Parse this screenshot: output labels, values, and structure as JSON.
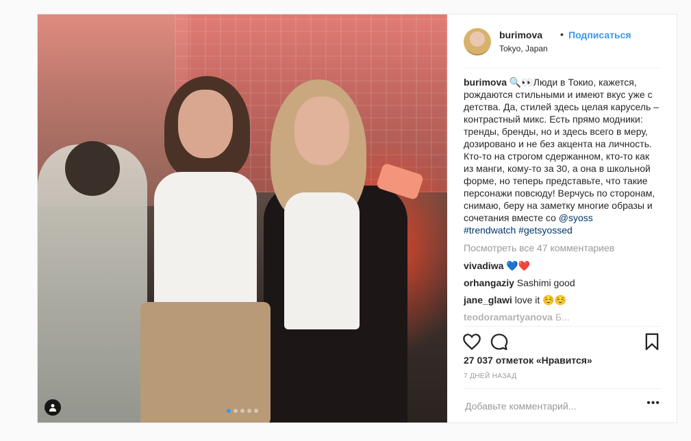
{
  "post": {
    "username": "burimova",
    "separator": "•",
    "follow_label": "Подписаться",
    "location": "Tokyo, Japan",
    "caption_user": "burimova",
    "caption_text": " 🔍👀Люди в Токио, кажется, рождаются стильными и имеют вкус уже с детства. Да, стилей здесь целая карусель – контрастный микс. Есть прямо модники: тренды, бренды, но и здесь всего в меру, дозировано и не без акцента на личность. Кто-то на строгом сдержанном, кто-то как из манги, кому-то за 30, а она в школьной форме, но теперь представьте, что такие персонажи повсюду! Верчусь по сторонам, снимаю, беру на заметку многие образы и сочетания вместе со ",
    "mention": "@syoss",
    "hashtags": "#trendwatch #getsyossed",
    "view_all": "Посмотреть все 47 комментариев",
    "comments": [
      {
        "user": "vivadiwa",
        "text": "💙❤️"
      },
      {
        "user": "orhangaziy",
        "text": "Sashimi good"
      },
      {
        "user": "jane_glawi",
        "text": "love it ☺️☺️"
      },
      {
        "user": "teodoramartyanova",
        "text": "Б..."
      }
    ],
    "likes": "27 037 отметок «Нравится»",
    "time": "7 ДНЕЙ НАЗАД",
    "add_comment_placeholder": "Добавьте комментарий...",
    "more_label": "•••",
    "carousel": {
      "count": 5,
      "active": 0
    }
  },
  "icons": {
    "like": "heart-icon",
    "comment": "comment-icon",
    "save": "bookmark-icon",
    "tag": "user-tag-icon"
  },
  "colors": {
    "link": "#3897f0",
    "hashtag": "#003569",
    "muted": "#999999"
  }
}
